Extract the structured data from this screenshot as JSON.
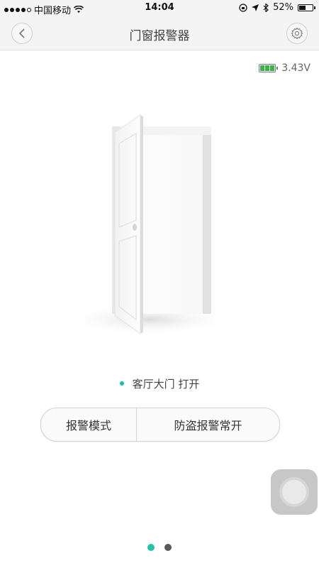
{
  "status_bar": {
    "carrier": "中国移动",
    "time": "14:04",
    "battery_percent": "52%",
    "battery_level": 0.52,
    "icons": [
      "signal-dots-icon",
      "wifi-icon",
      "lock-rotation-icon",
      "location-arrow-icon",
      "bluetooth-icon",
      "battery-icon"
    ]
  },
  "nav": {
    "title": "门窗报警器",
    "back_icon": "chevron-left-icon",
    "settings_icon": "gear-icon"
  },
  "device": {
    "voltage": "3.43V",
    "battery_bars": 3,
    "status_text": "客厅大门 打开",
    "status_color": "#1fbfa4"
  },
  "segmented": {
    "left_label": "报警模式",
    "right_label": "防盗报警常开"
  },
  "pager": {
    "count": 2,
    "active_index": 0,
    "active_color": "#22c3a9"
  }
}
